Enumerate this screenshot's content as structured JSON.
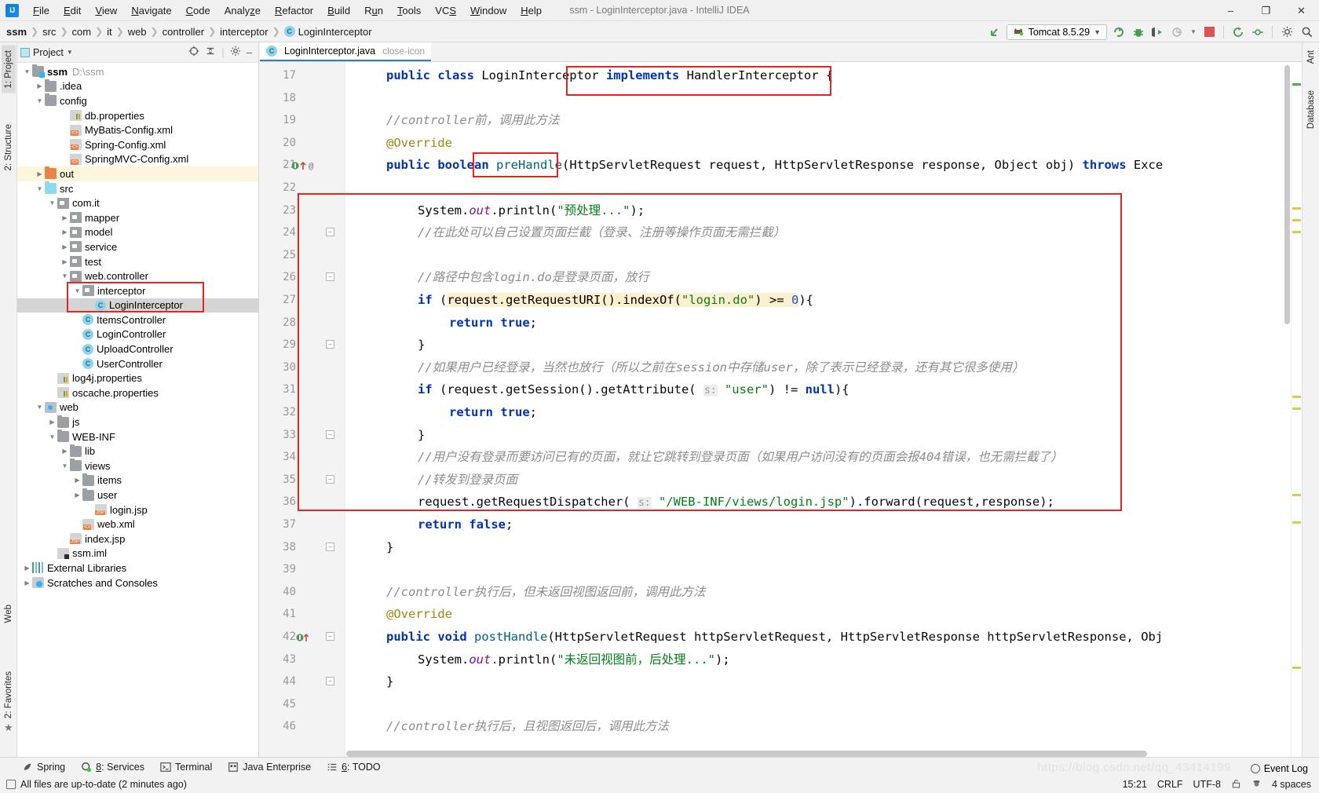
{
  "window": {
    "title": "ssm - LoginInterceptor.java - IntelliJ IDEA",
    "logo": "intellij-idea-logo",
    "minimize": "–",
    "maximize": "❐",
    "close": "✕"
  },
  "menubar": [
    {
      "label": "File"
    },
    {
      "label": "Edit"
    },
    {
      "label": "View"
    },
    {
      "label": "Navigate"
    },
    {
      "label": "Code"
    },
    {
      "label": "Analyze"
    },
    {
      "label": "Refactor"
    },
    {
      "label": "Build"
    },
    {
      "label": "Run"
    },
    {
      "label": "Tools"
    },
    {
      "label": "VCS"
    },
    {
      "label": "Window"
    },
    {
      "label": "Help"
    }
  ],
  "breadcrumb": [
    {
      "label": "ssm",
      "root": true
    },
    {
      "label": "src"
    },
    {
      "label": "com"
    },
    {
      "label": "it"
    },
    {
      "label": "web"
    },
    {
      "label": "controller"
    },
    {
      "label": "interceptor"
    },
    {
      "label": "LoginInterceptor",
      "badge": "C"
    }
  ],
  "toolbar": {
    "back_arrow_icon": "arrow-up-left-icon",
    "run_config_label": "Tomcat 8.5.29",
    "run_config_icon": "tomcat-cat-icon",
    "dropdown_icon": "chevron-down-icon",
    "run_icon": "run-icon",
    "debug_icon": "debug-bug-icon",
    "run_coverage_icon": "run-with-coverage-icon",
    "profile_icon": "profiler-icon",
    "stop_icon": "stop-icon",
    "search_icon": "search-everywhere-icon",
    "settings_icon": "settings-icon",
    "expand_icon": "expand-icon"
  },
  "left_strips": [
    {
      "label": "1: Project",
      "active": true
    },
    {
      "label": "2: Structure",
      "active": false
    },
    {
      "label": "Web",
      "active": false
    },
    {
      "label": "2: Favorites",
      "active": false
    }
  ],
  "right_strips": [
    {
      "label": "Ant"
    },
    {
      "label": "Database"
    }
  ],
  "project_panel": {
    "title": "Project",
    "chevron_icon": "chevron-down-icon",
    "target_icon": "scroll-from-source-icon",
    "collapse_icon": "collapse-all-icon",
    "gear_icon": "gear-icon",
    "hide_icon": "hide-icon",
    "tree": [
      {
        "depth": 0,
        "arrow": "down",
        "icon": "module-folder",
        "label": "ssm",
        "bold": true,
        "sub": "D:\\ssm"
      },
      {
        "depth": 1,
        "arrow": "right",
        "icon": "folder-grey",
        "label": ".idea"
      },
      {
        "depth": 1,
        "arrow": "down",
        "icon": "folder-grey",
        "label": "config"
      },
      {
        "depth": 3,
        "arrow": "none",
        "icon": "properties",
        "label": "db.properties"
      },
      {
        "depth": 3,
        "arrow": "none",
        "icon": "xml",
        "label": "MyBatis-Config.xml"
      },
      {
        "depth": 3,
        "arrow": "none",
        "icon": "xml",
        "label": "Spring-Config.xml"
      },
      {
        "depth": 3,
        "arrow": "none",
        "icon": "xml",
        "label": "SpringMVC-Config.xml"
      },
      {
        "depth": 1,
        "arrow": "right",
        "icon": "folder-orange",
        "label": "out",
        "highlighted": true
      },
      {
        "depth": 1,
        "arrow": "down",
        "icon": "folder-blue",
        "label": "src"
      },
      {
        "depth": 2,
        "arrow": "down",
        "icon": "package",
        "label": "com.it"
      },
      {
        "depth": 3,
        "arrow": "right",
        "icon": "package",
        "label": "mapper"
      },
      {
        "depth": 3,
        "arrow": "right",
        "icon": "package",
        "label": "model"
      },
      {
        "depth": 3,
        "arrow": "right",
        "icon": "package",
        "label": "service"
      },
      {
        "depth": 3,
        "arrow": "right",
        "icon": "package",
        "label": "test"
      },
      {
        "depth": 3,
        "arrow": "down",
        "icon": "package",
        "label": "web.controller"
      },
      {
        "depth": 4,
        "arrow": "down",
        "icon": "package",
        "label": "interceptor"
      },
      {
        "depth": 5,
        "arrow": "none",
        "icon": "class",
        "label": "LoginInterceptor",
        "selected": true
      },
      {
        "depth": 4,
        "arrow": "none",
        "icon": "class",
        "label": "ItemsController"
      },
      {
        "depth": 4,
        "arrow": "none",
        "icon": "class",
        "label": "LoginController"
      },
      {
        "depth": 4,
        "arrow": "none",
        "icon": "class",
        "label": "UploadController"
      },
      {
        "depth": 4,
        "arrow": "none",
        "icon": "class",
        "label": "UserController"
      },
      {
        "depth": 2,
        "arrow": "none",
        "icon": "properties",
        "label": "log4j.properties"
      },
      {
        "depth": 2,
        "arrow": "none",
        "icon": "properties",
        "label": "oscache.properties"
      },
      {
        "depth": 1,
        "arrow": "down",
        "icon": "web-root",
        "label": "web"
      },
      {
        "depth": 2,
        "arrow": "right",
        "icon": "folder-grey",
        "label": "js"
      },
      {
        "depth": 2,
        "arrow": "down",
        "icon": "folder-grey",
        "label": "WEB-INF"
      },
      {
        "depth": 3,
        "arrow": "right",
        "icon": "folder-grey",
        "label": "lib"
      },
      {
        "depth": 3,
        "arrow": "down",
        "icon": "folder-grey",
        "label": "views"
      },
      {
        "depth": 4,
        "arrow": "right",
        "icon": "folder-grey",
        "label": "items"
      },
      {
        "depth": 4,
        "arrow": "right",
        "icon": "folder-grey",
        "label": "user"
      },
      {
        "depth": 5,
        "arrow": "none",
        "icon": "jsp",
        "label": "login.jsp"
      },
      {
        "depth": 4,
        "arrow": "none",
        "icon": "xml",
        "label": "web.xml"
      },
      {
        "depth": 3,
        "arrow": "none",
        "icon": "jsp",
        "label": "index.jsp"
      },
      {
        "depth": 2,
        "arrow": "none",
        "icon": "iml",
        "label": "ssm.iml"
      },
      {
        "depth": 0,
        "arrow": "right",
        "icon": "libraries",
        "label": "External Libraries"
      },
      {
        "depth": 0,
        "arrow": "right",
        "icon": "scratches",
        "label": "Scratches and Consoles"
      }
    ]
  },
  "editor": {
    "tab": {
      "label": "LoginInterceptor.java",
      "badge": "C",
      "close_icon": "close-icon"
    },
    "first_line_number": 17,
    "lines": [
      {
        "n": 17,
        "indent": 1,
        "tokens": [
          {
            "t": "public ",
            "c": "kw"
          },
          {
            "t": "class ",
            "c": "kw"
          },
          {
            "t": "LoginInterceptor ",
            "c": "plain"
          },
          {
            "t": "implements",
            "c": "kw"
          },
          {
            "t": " HandlerInterceptor {",
            "c": "plain"
          }
        ]
      },
      {
        "n": 18,
        "indent": 1,
        "tokens": []
      },
      {
        "n": 19,
        "indent": 1,
        "tokens": [
          {
            "t": "//controller前，调用此方法",
            "c": "cm"
          }
        ]
      },
      {
        "n": 20,
        "indent": 1,
        "tokens": [
          {
            "t": "@Override",
            "c": "ann"
          }
        ]
      },
      {
        "n": 21,
        "indent": 1,
        "gutter": "method-run-marker",
        "tokens": [
          {
            "t": "public ",
            "c": "kw"
          },
          {
            "t": "boolean ",
            "c": "kw"
          },
          {
            "t": "preHandle",
            "c": "mth"
          },
          {
            "t": "(HttpServletRequest request, HttpServletResponse response, Object obj) ",
            "c": "plain"
          },
          {
            "t": "throws",
            "c": "kw"
          },
          {
            "t": " Exce",
            "c": "plain"
          }
        ]
      },
      {
        "n": 22,
        "indent": 1,
        "tokens": []
      },
      {
        "n": 23,
        "indent": 2,
        "tokens": [
          {
            "t": "System.",
            "c": "plain"
          },
          {
            "t": "out",
            "c": "fld"
          },
          {
            "t": ".println(",
            "c": "plain"
          },
          {
            "t": "\"预处理...\"",
            "c": "str"
          },
          {
            "t": ");",
            "c": "plain"
          }
        ]
      },
      {
        "n": 24,
        "indent": 2,
        "tokens": [
          {
            "t": "//在此处可以自己设置页面拦截（登录、注册等操作页面无需拦截）",
            "c": "cm"
          }
        ]
      },
      {
        "n": 25,
        "indent": 2,
        "tokens": []
      },
      {
        "n": 26,
        "indent": 2,
        "tokens": [
          {
            "t": "//路径中包含login.do是登录页面，放行",
            "c": "cm"
          }
        ]
      },
      {
        "n": 27,
        "indent": 2,
        "tokens": [
          {
            "t": "if ",
            "c": "kw"
          },
          {
            "t": "(",
            "c": "plain"
          },
          {
            "t": "request.getRequestURI().indexOf(",
            "c": "hl"
          },
          {
            "t": "\"login.do\"",
            "c": "str hl"
          },
          {
            "t": ") >= ",
            "c": "hl"
          },
          {
            "t": "0",
            "c": "num hl"
          },
          {
            "t": "){",
            "c": "plain"
          }
        ]
      },
      {
        "n": 28,
        "indent": 3,
        "tokens": [
          {
            "t": "return ",
            "c": "kw"
          },
          {
            "t": "true",
            "c": "kw"
          },
          {
            "t": ";",
            "c": "plain"
          }
        ]
      },
      {
        "n": 29,
        "indent": 2,
        "tokens": [
          {
            "t": "}",
            "c": "plain"
          }
        ]
      },
      {
        "n": 30,
        "indent": 2,
        "tokens": [
          {
            "t": "//如果用户已经登录，当然也放行（所以之前在session中存储user，除了表示已经登录，还有其它很多使用）",
            "c": "cm"
          }
        ]
      },
      {
        "n": 31,
        "indent": 2,
        "tokens": [
          {
            "t": "if ",
            "c": "kw"
          },
          {
            "t": "(request.getSession().getAttribute( ",
            "c": "plain"
          },
          {
            "t": "s:",
            "c": "hint"
          },
          {
            "t": " ",
            "c": "plain"
          },
          {
            "t": "\"user\"",
            "c": "str"
          },
          {
            "t": ") != ",
            "c": "plain"
          },
          {
            "t": "null",
            "c": "kw"
          },
          {
            "t": "){",
            "c": "plain"
          }
        ]
      },
      {
        "n": 32,
        "indent": 3,
        "tokens": [
          {
            "t": "return ",
            "c": "kw"
          },
          {
            "t": "true",
            "c": "kw"
          },
          {
            "t": ";",
            "c": "plain"
          }
        ]
      },
      {
        "n": 33,
        "indent": 2,
        "tokens": [
          {
            "t": "}",
            "c": "plain"
          }
        ]
      },
      {
        "n": 34,
        "indent": 2,
        "tokens": [
          {
            "t": "//用户没有登录而要访问已有的页面，就让它跳转到登录页面（如果用户访问没有的页面会报404错误，也无需拦截了）",
            "c": "cm"
          }
        ]
      },
      {
        "n": 35,
        "indent": 2,
        "tokens": [
          {
            "t": "//转发到登录页面",
            "c": "cm"
          }
        ]
      },
      {
        "n": 36,
        "indent": 2,
        "tokens": [
          {
            "t": "request.getRequestDispatcher( ",
            "c": "plain"
          },
          {
            "t": "s:",
            "c": "hint"
          },
          {
            "t": " ",
            "c": "plain"
          },
          {
            "t": "\"/WEB-INF/views/login.jsp\"",
            "c": "str"
          },
          {
            "t": ").forward(request,response);",
            "c": "plain"
          }
        ]
      },
      {
        "n": 37,
        "indent": 2,
        "tokens": [
          {
            "t": "return ",
            "c": "kw"
          },
          {
            "t": "false",
            "c": "kw"
          },
          {
            "t": ";",
            "c": "plain"
          }
        ]
      },
      {
        "n": 38,
        "indent": 1,
        "tokens": [
          {
            "t": "}",
            "c": "plain"
          }
        ]
      },
      {
        "n": 39,
        "indent": 1,
        "tokens": []
      },
      {
        "n": 40,
        "indent": 1,
        "tokens": [
          {
            "t": "//controller执行后，但未返回视图返回前，调用此方法",
            "c": "cm"
          }
        ]
      },
      {
        "n": 41,
        "indent": 1,
        "tokens": [
          {
            "t": "@Override",
            "c": "ann"
          }
        ]
      },
      {
        "n": 42,
        "indent": 1,
        "gutter": "method-override-marker",
        "tokens": [
          {
            "t": "public ",
            "c": "kw"
          },
          {
            "t": "void ",
            "c": "kw"
          },
          {
            "t": "postHandle",
            "c": "mth"
          },
          {
            "t": "(HttpServletRequest httpServletRequest, HttpServletResponse httpServletResponse, Obj",
            "c": "plain"
          }
        ]
      },
      {
        "n": 43,
        "indent": 2,
        "tokens": [
          {
            "t": "System.",
            "c": "plain"
          },
          {
            "t": "out",
            "c": "fld"
          },
          {
            "t": ".println(",
            "c": "plain"
          },
          {
            "t": "\"未返回视图前，后处理...\"",
            "c": "str"
          },
          {
            "t": ");",
            "c": "plain"
          }
        ]
      },
      {
        "n": 44,
        "indent": 1,
        "tokens": [
          {
            "t": "}",
            "c": "plain"
          }
        ]
      },
      {
        "n": 45,
        "indent": 1,
        "tokens": []
      },
      {
        "n": 46,
        "indent": 1,
        "tokens": [
          {
            "t": "//controller执行后，且视图返回后，调用此方法",
            "c": "cm"
          }
        ]
      }
    ]
  },
  "bottom_tools": [
    {
      "label": "Spring",
      "icon": "spring-leaf-icon"
    },
    {
      "label": "8: Services",
      "icon": "services-icon"
    },
    {
      "label": "Terminal",
      "icon": "terminal-icon"
    },
    {
      "label": "Java Enterprise",
      "icon": "java-enterprise-icon"
    },
    {
      "label": "6: TODO",
      "icon": "todo-list-icon"
    }
  ],
  "status": {
    "message": "All files are up-to-date (2 minutes ago)",
    "message_icon": "file-sync-icon",
    "event_log": "Event Log",
    "event_log_icon": "event-log-icon",
    "time": "15:21",
    "line_separator": "CRLF",
    "encoding": "UTF-8",
    "lock_icon": "unlocked-icon",
    "inspection_icon": "hector-inspection-icon",
    "indent": "4 spaces",
    "watermark": "https://blog.csdn.net/qq_43414199"
  },
  "colors": {
    "accent_blue": "#0033b3",
    "annotation_red": "#ed2024",
    "string_green": "#067d17",
    "comment_grey": "#8c8c8c",
    "highlight_yellow": "#fcf0cf",
    "selection_grey": "#d4d4d4",
    "stop_red": "#e05252",
    "run_green": "#4a9c52"
  }
}
